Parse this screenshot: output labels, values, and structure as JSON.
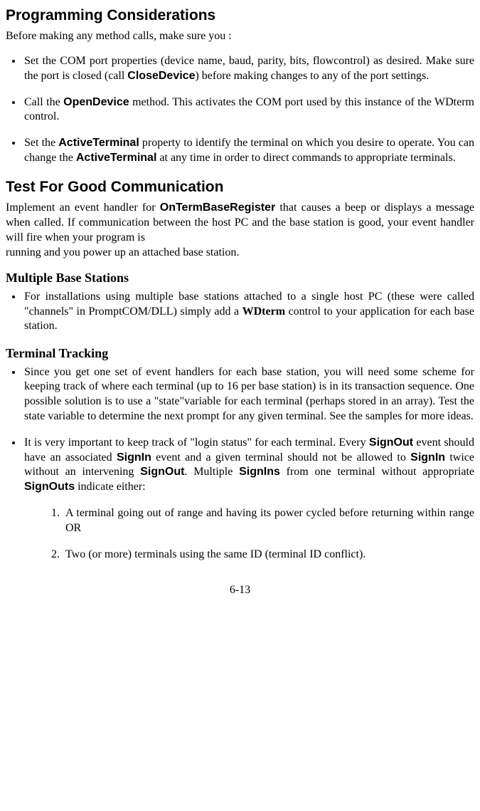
{
  "sections": {
    "prog": {
      "heading": "Programming Considerations",
      "intro": "Before making any method calls, make sure you :",
      "bullets": [
        {
          "pre1": "Set the COM port properties (device name, baud, parity, bits, flowcontrol) as desired. Make sure the port is closed (call ",
          "b1": "CloseDevice",
          "post1": ") before making changes to any of the port settings."
        },
        {
          "pre1": "Call the ",
          "b1": "OpenDevice",
          "post1": " method. This activates the COM port used by this instance of the WDterm control."
        },
        {
          "pre1": "Set the ",
          "b1": "ActiveTerminal",
          "mid1": " property to identify the terminal on which you desire to operate. You can change the ",
          "b2": "ActiveTerminal",
          "post1": " at any time in order to direct commands to appropriate terminals."
        }
      ]
    },
    "test": {
      "heading": "Test For Good Communication",
      "para_pre": "Implement an event handler for ",
      "para_b": "OnTermBaseRegister",
      "para_post": " that causes a beep or displays a message when called. If communication between the host PC and the base station is good, your event handler will fire when your program is",
      "para_line2": "running and you power up an attached base station."
    },
    "multi": {
      "heading": "Multiple Base Stations",
      "bullet_pre": "For installations using multiple base stations attached to a single host PC (these were called \"channels\" in PromptCOM/DLL) simply add a ",
      "bullet_b": "WDterm",
      "bullet_post": " control to your application for each base station."
    },
    "track": {
      "heading": "Terminal Tracking",
      "bullet1": "Since you get one set of event handlers for each base station, you will need some scheme for keeping track of where each terminal (up to 16 per base station) is in its transaction sequence. One possible solution is to use a \"state\"variable for each terminal (perhaps stored in an array). Test the state variable to determine the next prompt for any given terminal. See the samples for more ideas.",
      "bullet2": {
        "t1": "It is very important to keep track of \"login status\" for each terminal. Every ",
        "b1": "SignOut",
        "t2": " event should have an associated ",
        "b2": "SignIn",
        "t3": " event and a given terminal should not be allowed to ",
        "b3": "SignIn",
        "t4": " twice without an intervening ",
        "b4": "SignOut",
        "t5": ". Multiple ",
        "b5": "SignIns",
        "t6": " from one terminal without appropriate ",
        "b6": "SignOuts",
        "t7": " indicate either:"
      },
      "numbered": [
        "A terminal going out of range and having its power cycled before returning within range OR",
        "Two (or more) terminals using the same ID (terminal ID conflict)."
      ]
    }
  },
  "footer": "6-13"
}
